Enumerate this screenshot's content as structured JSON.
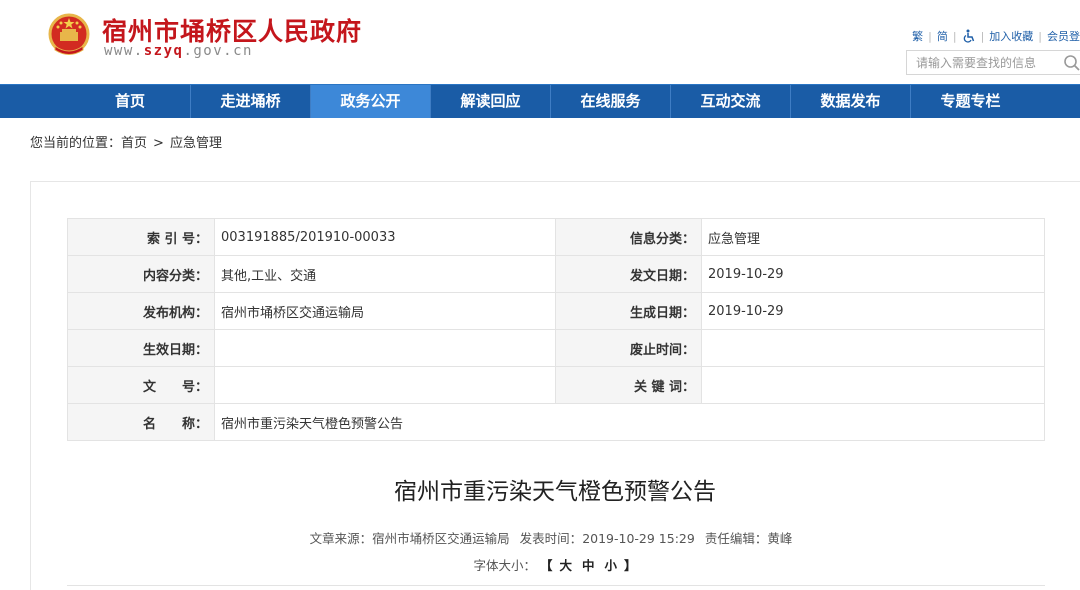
{
  "header": {
    "site_title": "宿州市埇桥区人民政府",
    "site_url_prefix": "www.",
    "site_url_highlight": "szyq",
    "site_url_suffix": ".gov.cn",
    "tools": {
      "traditional": "繁",
      "simplified": "简",
      "accessibility_icon": "wheelchair-icon",
      "bookmark": "加入收藏",
      "member_login": "会员登"
    },
    "search": {
      "placeholder": "请输入需要查找的信息",
      "icon": "search-icon"
    }
  },
  "nav": {
    "items": [
      {
        "label": "首页"
      },
      {
        "label": "走进埇桥"
      },
      {
        "label": "政务公开"
      },
      {
        "label": "解读回应"
      },
      {
        "label": "在线服务"
      },
      {
        "label": "互动交流"
      },
      {
        "label": "数据发布"
      },
      {
        "label": "专题专栏"
      }
    ],
    "active_index": 2
  },
  "breadcrumb": {
    "prefix": "您当前的位置：",
    "home": "首页",
    "separator": ">",
    "current": "应急管理"
  },
  "meta": {
    "index_no_label": "索 引 号：",
    "index_no": "003191885/201910-00033",
    "info_category_label": "信息分类：",
    "info_category": "应急管理",
    "content_category_label": "内容分类：",
    "content_category": "其他,工业、交通",
    "issue_date_label": "发文日期：",
    "issue_date": "2019-10-29",
    "publisher_label": "发布机构：",
    "publisher": "宿州市埇桥区交通运输局",
    "generated_date_label": "生成日期：",
    "generated_date": "2019-10-29",
    "effective_date_label": "生效日期：",
    "effective_date": "",
    "repeal_date_label": "废止时间：",
    "repeal_date": "",
    "doc_no_label": "文　　号：",
    "doc_no": "",
    "keywords_label": "关 键 词：",
    "keywords": "",
    "name_label": "名　　称：",
    "name": "宿州市重污染天气橙色预警公告"
  },
  "article": {
    "title": "宿州市重污染天气橙色预警公告",
    "source_label": "文章来源：",
    "source": "宿州市埇桥区交通运输局",
    "publish_time_label": "发表时间：",
    "publish_time": "2019-10-29 15:29",
    "editor_label": "责任编辑：",
    "editor": "黄峰",
    "font_size_label": "字体大小：",
    "font_bracket_open": "【",
    "font_large": "大",
    "font_medium": "中",
    "font_small": "小",
    "font_bracket_close": "】"
  },
  "colors": {
    "brand_red": "#c4161c",
    "nav_blue": "#1a5ca6",
    "nav_active": "#3d88d8",
    "link_blue": "#1f5fa8"
  }
}
